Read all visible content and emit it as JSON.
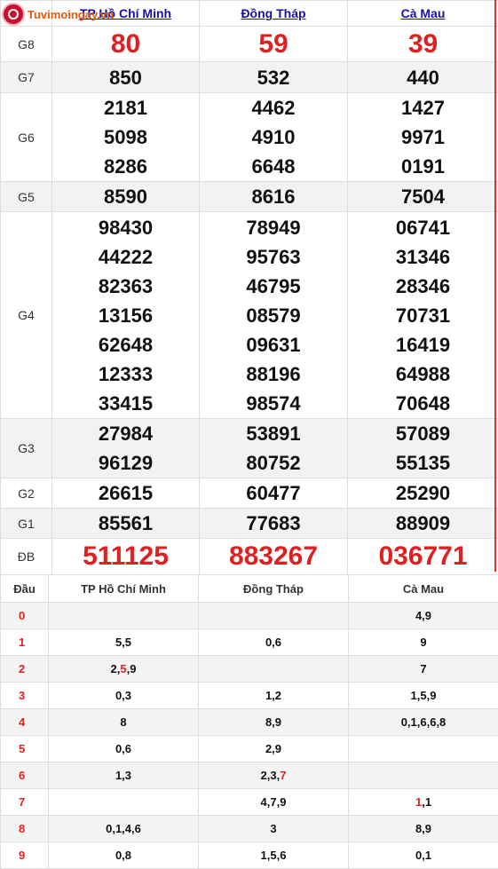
{
  "logo": {
    "text": "Tuvimoingay.vn"
  },
  "provinces": [
    "TP Hồ Chí Minh",
    "Đồng Tháp",
    "Cà Mau"
  ],
  "prizes": {
    "g8": {
      "label": "G8",
      "values": [
        "80",
        "59",
        "39"
      ]
    },
    "g7": {
      "label": "G7",
      "values": [
        "850",
        "532",
        "440"
      ]
    },
    "g6": {
      "label": "G6",
      "values": [
        [
          "2181",
          "5098",
          "8286"
        ],
        [
          "4462",
          "4910",
          "6648"
        ],
        [
          "1427",
          "9971",
          "0191"
        ]
      ]
    },
    "g5": {
      "label": "G5",
      "values": [
        "8590",
        "8616",
        "7504"
      ]
    },
    "g4": {
      "label": "G4",
      "values": [
        [
          "98430",
          "44222",
          "82363",
          "13156",
          "62648",
          "12333",
          "33415"
        ],
        [
          "78949",
          "95763",
          "46795",
          "08579",
          "09631",
          "88196",
          "98574"
        ],
        [
          "06741",
          "31346",
          "28346",
          "70731",
          "16419",
          "64988",
          "70648"
        ]
      ]
    },
    "g3": {
      "label": "G3",
      "values": [
        [
          "27984",
          "96129"
        ],
        [
          "53891",
          "80752"
        ],
        [
          "57089",
          "55135"
        ]
      ]
    },
    "g2": {
      "label": "G2",
      "values": [
        "26615",
        "60477",
        "25290"
      ]
    },
    "g1": {
      "label": "G1",
      "values": [
        "85561",
        "77683",
        "88909"
      ]
    },
    "db": {
      "label": "ĐB",
      "values": [
        "511125",
        "883267",
        "036771"
      ]
    }
  },
  "loto": {
    "header": {
      "dau": "Đầu",
      "cols": [
        "TP Hồ Chí Minh",
        "Đồng Tháp",
        "Cà Mau"
      ]
    },
    "rows": [
      {
        "dau": "0",
        "cells": [
          "",
          "",
          "4,9"
        ]
      },
      {
        "dau": "1",
        "cells": [
          "5,5",
          "0,6",
          "9"
        ]
      },
      {
        "dau": "2",
        "cells": [
          "2,5,9",
          "",
          "7"
        ]
      },
      {
        "dau": "3",
        "cells": [
          "0,3",
          "1,2",
          "1,5,9"
        ]
      },
      {
        "dau": "4",
        "cells": [
          "8",
          "8,9",
          "0,1,6,6,8"
        ]
      },
      {
        "dau": "5",
        "cells": [
          "0,6",
          "2,9",
          ""
        ]
      },
      {
        "dau": "6",
        "cells": [
          "1,3",
          "2,3,7",
          ""
        ]
      },
      {
        "dau": "7",
        "cells": [
          "",
          "4,7,9",
          "1,1"
        ]
      },
      {
        "dau": "8",
        "cells": [
          "0,1,4,6",
          "3",
          "8,9"
        ]
      },
      {
        "dau": "9",
        "cells": [
          "0,8",
          "1,5,6",
          "0,1"
        ]
      }
    ],
    "highlights": [
      {
        "row": 2,
        "col": 0,
        "index": 1
      },
      {
        "row": 6,
        "col": 1,
        "index": 2
      },
      {
        "row": 7,
        "col": 2,
        "index": 0
      }
    ]
  },
  "colors": {
    "accent_red": "#e02020",
    "link_blue": "#1a0dab",
    "logo_orange": "#e8590c"
  }
}
